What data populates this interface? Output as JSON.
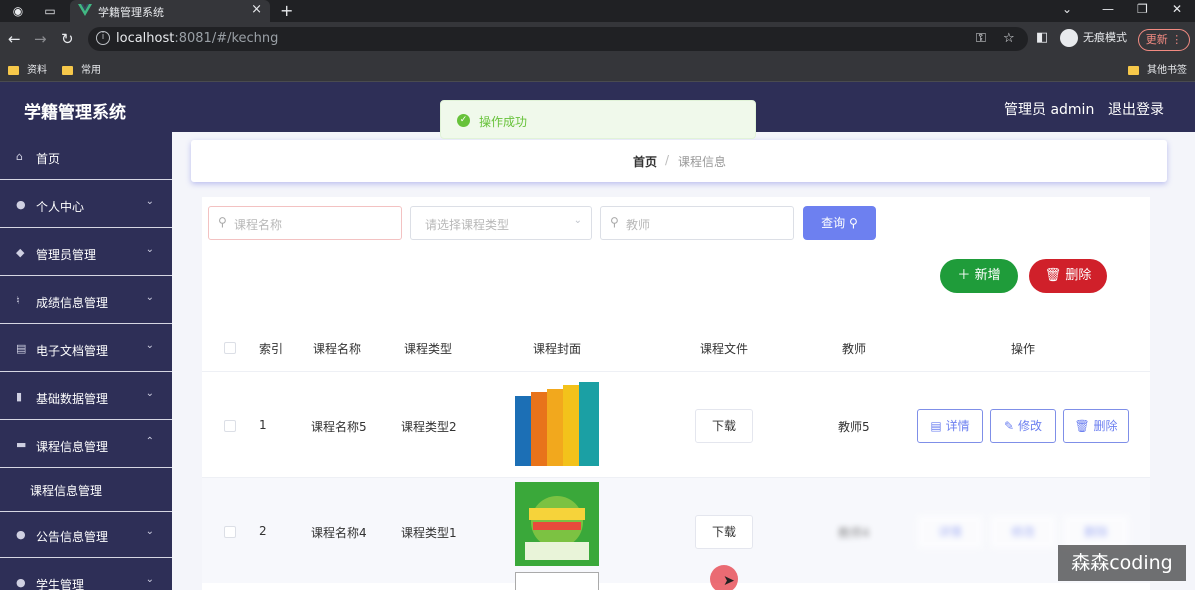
{
  "browser": {
    "tab_title": "学籍管理系统",
    "url_host": "localhost",
    "url_rest": ":8081/#/kechng",
    "profile_label": "无痕模式",
    "update_label": "更新",
    "bookmarks": [
      "资料",
      "常用"
    ],
    "other_bookmarks": "其他书签"
  },
  "app": {
    "title": "学籍管理系统",
    "admin_label": "管理员 admin",
    "logout_label": "退出登录"
  },
  "sidebar": {
    "items": [
      {
        "label": "首页",
        "icon": "home-icon"
      },
      {
        "label": "个人中心",
        "icon": "user-icon"
      },
      {
        "label": "管理员管理",
        "icon": "pin-icon"
      },
      {
        "label": "成绩信息管理",
        "icon": "mic-icon"
      },
      {
        "label": "电子文档管理",
        "icon": "document-icon"
      },
      {
        "label": "基础数据管理",
        "icon": "chart-icon"
      },
      {
        "label": "课程信息管理",
        "icon": "chat-icon"
      },
      {
        "label": "公告信息管理",
        "icon": "user-icon"
      },
      {
        "label": "学生管理",
        "icon": "user-icon"
      }
    ],
    "submenu_label": "课程信息管理"
  },
  "breadcrumb": {
    "home": "首页",
    "separator": "/",
    "current": "课程信息"
  },
  "toast": {
    "message": "操作成功"
  },
  "search": {
    "course_name_placeholder": "课程名称",
    "course_type_placeholder": "请选择课程类型",
    "teacher_placeholder": "教师",
    "query_label": "查询"
  },
  "actions": {
    "add_label": "新增",
    "delete_label": "删除"
  },
  "table": {
    "headers": [
      "索引",
      "课程名称",
      "课程类型",
      "课程封面",
      "课程文件",
      "教师",
      "操作"
    ],
    "rows": [
      {
        "index": "1",
        "name": "课程名称5",
        "type": "课程类型2",
        "download": "下载",
        "teacher": "教师5",
        "detail": "详情",
        "edit": "修改",
        "delete": "删除"
      },
      {
        "index": "2",
        "name": "课程名称4",
        "type": "课程类型1",
        "download": "下载",
        "teacher": "教师4",
        "detail": "详情",
        "edit": "修改",
        "delete": "删除"
      }
    ]
  },
  "watermark": "森森coding"
}
